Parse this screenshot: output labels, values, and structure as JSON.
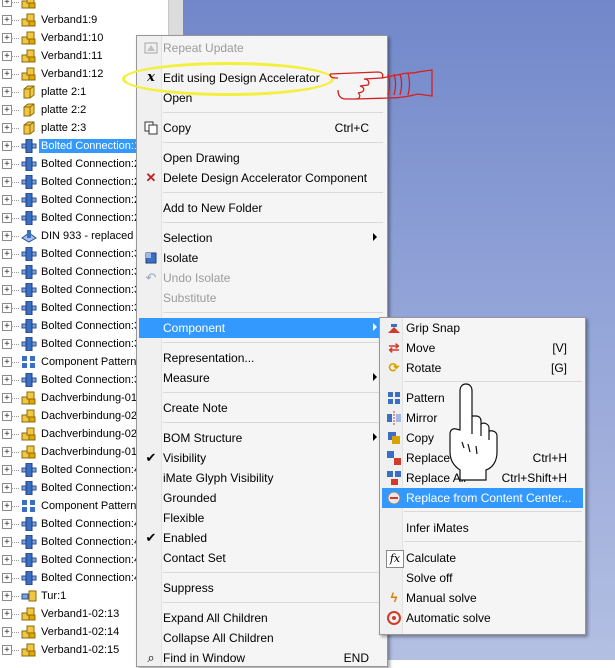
{
  "tree": {
    "rows": [
      {
        "label": "",
        "icon": "assembly-icon"
      },
      {
        "label": "Verband1:9",
        "icon": "assembly-icon"
      },
      {
        "label": "Verband1:10",
        "icon": "assembly-icon"
      },
      {
        "label": "Verband1:11",
        "icon": "assembly-icon"
      },
      {
        "label": "Verband1:12",
        "icon": "assembly-icon"
      },
      {
        "label": "platte 2:1",
        "icon": "part-icon"
      },
      {
        "label": "platte 2:2",
        "icon": "part-icon"
      },
      {
        "label": "platte 2:3",
        "icon": "part-icon"
      },
      {
        "label": "Bolted Connection:1",
        "icon": "bolted-connection-icon",
        "selected": true
      },
      {
        "label": "Bolted Connection:2",
        "icon": "bolted-connection-icon"
      },
      {
        "label": "Bolted Connection:2",
        "icon": "bolted-connection-icon"
      },
      {
        "label": "Bolted Connection:2",
        "icon": "bolted-connection-icon"
      },
      {
        "label": "Bolted Connection:2",
        "icon": "bolted-connection-icon"
      },
      {
        "label": "DIN 933 - replaced b",
        "icon": "content-center-icon"
      },
      {
        "label": "Bolted Connection:3",
        "icon": "bolted-connection-icon"
      },
      {
        "label": "Bolted Connection:3",
        "icon": "bolted-connection-icon"
      },
      {
        "label": "Bolted Connection:3",
        "icon": "bolted-connection-icon"
      },
      {
        "label": "Bolted Connection:3",
        "icon": "bolted-connection-icon"
      },
      {
        "label": "Bolted Connection:3",
        "icon": "bolted-connection-icon"
      },
      {
        "label": "Bolted Connection:3",
        "icon": "bolted-connection-icon"
      },
      {
        "label": "Component Pattern",
        "icon": "pattern-icon"
      },
      {
        "label": "Bolted Connection:3",
        "icon": "bolted-connection-icon"
      },
      {
        "label": "Dachverbindung-01",
        "icon": "assembly-icon"
      },
      {
        "label": "Dachverbindung-02",
        "icon": "assembly-icon"
      },
      {
        "label": "Dachverbindung-02",
        "icon": "assembly-icon"
      },
      {
        "label": "Dachverbindung-01",
        "icon": "assembly-icon"
      },
      {
        "label": "Bolted Connection:4",
        "icon": "bolted-connection-icon"
      },
      {
        "label": "Bolted Connection:4",
        "icon": "bolted-connection-icon"
      },
      {
        "label": "Component Pattern",
        "icon": "pattern-icon"
      },
      {
        "label": "Bolted Connection:4",
        "icon": "bolted-connection-icon"
      },
      {
        "label": "Bolted Connection:4",
        "icon": "bolted-connection-icon"
      },
      {
        "label": "Bolted Connection:4",
        "icon": "bolted-connection-icon"
      },
      {
        "label": "Bolted Connection:4",
        "icon": "bolted-connection-icon"
      },
      {
        "label": "Tur:1",
        "icon": "door-assembly-icon"
      },
      {
        "label": "Verband1-02:13",
        "icon": "assembly-icon"
      },
      {
        "label": "Verband1-02:14",
        "icon": "assembly-icon"
      },
      {
        "label": "Verband1-02:15",
        "icon": "assembly-icon"
      }
    ]
  },
  "menu": {
    "repeat_update": "Repeat Update",
    "edit_da": "Edit using Design Accelerator",
    "open": "Open",
    "copy": "Copy",
    "copy_shortcut": "Ctrl+C",
    "open_drawing": "Open Drawing",
    "delete_da": "Delete Design Accelerator Component",
    "add_folder": "Add to New Folder",
    "selection": "Selection",
    "isolate": "Isolate",
    "undo_isolate": "Undo Isolate",
    "substitute": "Substitute",
    "component": "Component",
    "representation": "Representation...",
    "measure": "Measure",
    "create_note": "Create Note",
    "bom_structure": "BOM Structure",
    "visibility": "Visibility",
    "imate_glyph": "iMate Glyph Visibility",
    "grounded": "Grounded",
    "flexible": "Flexible",
    "enabled": "Enabled",
    "contact_set": "Contact Set",
    "suppress": "Suppress",
    "expand_all": "Expand All Children",
    "collapse_all": "Collapse All Children",
    "find_window": "Find in Window",
    "find_shortcut": "END"
  },
  "submenu": {
    "grip_snap": "Grip Snap",
    "move": "Move",
    "move_shortcut": "[V]",
    "rotate": "Rotate",
    "rotate_shortcut": "[G]",
    "pattern": "Pattern",
    "mirror": "Mirror",
    "copy": "Copy",
    "replace": "Replace",
    "replace_shortcut": "Ctrl+H",
    "replace_all": "Replace All",
    "replace_all_shortcut": "Ctrl+Shift+H",
    "replace_cc": "Replace from Content Center...",
    "infer_imates": "Infer iMates",
    "calculate": "Calculate",
    "solve_off": "Solve off",
    "manual_solve": "Manual solve",
    "automatic_solve": "Automatic solve"
  },
  "colors": {
    "highlight": "#3399ff",
    "annotation_ellipse": "#f3ef3a",
    "annotation_hand": "#d42020",
    "viewport": "#8ea0d6"
  }
}
